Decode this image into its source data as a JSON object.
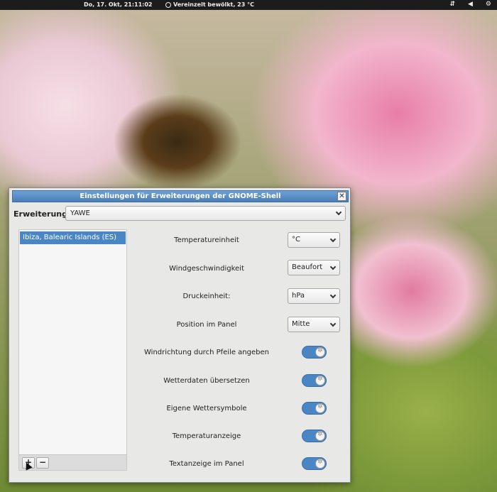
{
  "top_panel": {
    "clock": "Do, 17. Okt, 21:11:02",
    "weather": "Vereinzelt bewölkt, 23 °C",
    "tray_icons": [
      "network-icon",
      "volume-icon",
      "user-icon"
    ]
  },
  "window": {
    "title": "Einstellungen für Erweiterungen der GNOME-Shell",
    "close_label": "✕",
    "extension_label": "Erweiterung",
    "extension_value": "YAWE"
  },
  "locations": {
    "items": [
      "Ibiza, Balearic Islands (ES)"
    ],
    "add_label": "+",
    "remove_label": "−"
  },
  "settings": {
    "temp_unit": {
      "label": "Temperatureinheit",
      "value": "°C"
    },
    "wind_speed": {
      "label": "Windgeschwindigkeit",
      "value": "Beaufort"
    },
    "pressure_unit": {
      "label": "Druckeinheit:",
      "value": "hPa"
    },
    "panel_position": {
      "label": "Position im Panel",
      "value": "Mitte"
    },
    "wind_arrows": {
      "label": "Windrichtung durch Pfeile angeben",
      "on": true
    },
    "translate_data": {
      "label": "Wetterdaten übersetzen",
      "on": true
    },
    "own_symbols": {
      "label": "Eigene Wettersymbole",
      "on": true
    },
    "temp_display": {
      "label": "Temperaturanzeige",
      "on": true
    },
    "text_in_panel": {
      "label": "Textanzeige im Panel",
      "on": true
    }
  },
  "colors": {
    "accent": "#4a86c5",
    "panel_bg": "#1c1c1c",
    "window_bg": "#e8e8e7"
  }
}
